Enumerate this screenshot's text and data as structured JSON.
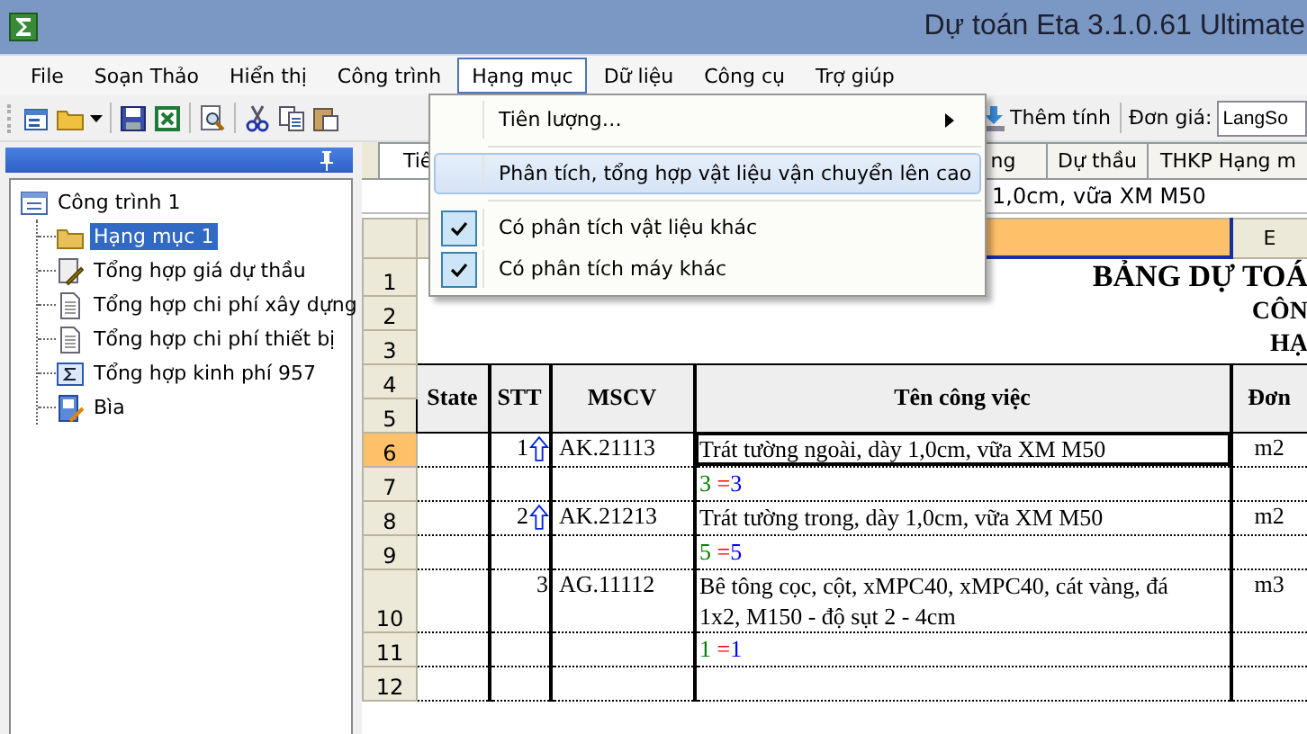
{
  "window": {
    "title": "Dự toán Eta 3.1.0.61 Ultimate"
  },
  "menu_bar": [
    {
      "label": "File",
      "selected": false
    },
    {
      "label": "Soạn Thảo",
      "selected": false
    },
    {
      "label": "Hiển thị",
      "selected": false
    },
    {
      "label": "Công trình",
      "selected": false
    },
    {
      "label": "Hạng mục",
      "selected": true
    },
    {
      "label": "Dữ liệu",
      "selected": false
    },
    {
      "label": "Công cụ",
      "selected": false
    },
    {
      "label": "Trợ giúp",
      "selected": false
    }
  ],
  "toolbar": {
    "add_button": "Thêm tính",
    "price_label": "Đơn giá:",
    "price_value": "LangSo"
  },
  "dropdown": [
    {
      "kind": "submenu",
      "label": "Tiên lượng…",
      "selected": false
    },
    {
      "kind": "action",
      "label": "Phân tích, tổng hợp vật liệu vận chuyển lên cao",
      "selected": true
    },
    {
      "kind": "toggle",
      "label": "Có phân tích vật liệu khác",
      "checked": true,
      "selected": false
    },
    {
      "kind": "toggle",
      "label": "Có phân tích máy khác",
      "checked": true,
      "selected": false
    }
  ],
  "tree": {
    "label": "Công trình 1",
    "children": [
      {
        "kind": "folder",
        "label": "Hạng mục 1",
        "selected": true
      },
      {
        "kind": "bid",
        "label": "Tổng hợp giá dự thầu",
        "selected": false
      },
      {
        "kind": "document",
        "label": "Tổng hợp chi phí xây dựng",
        "selected": false
      },
      {
        "kind": "document",
        "label": "Tổng hợp chi phí thiết bị",
        "selected": false
      },
      {
        "kind": "sum",
        "label": "Tổng hợp kinh phí 957",
        "selected": false
      },
      {
        "kind": "cover",
        "label": "Bìa",
        "selected": false
      }
    ]
  },
  "sheet_tabs": [
    {
      "label": "Tiê",
      "selected": true
    },
    {
      "label": "ng",
      "selected": false
    },
    {
      "label": "Dự thầu",
      "selected": false
    },
    {
      "label": "THKP Hạng m",
      "selected": false
    }
  ],
  "formula_bar": "1,0cm, vữa XM M50",
  "column_headers": [
    {
      "selected": true
    },
    {
      "label": "E",
      "selected": false
    }
  ],
  "title_lines": [
    {
      "number": "1",
      "text": "BẢNG DỰ TOÁ"
    },
    {
      "number": "2",
      "text": "CÔN"
    },
    {
      "number": "3",
      "text": "HẠ"
    }
  ],
  "header": {
    "numbers": [
      "4",
      "5"
    ],
    "cells": [
      "State",
      "STT",
      "MSCV",
      "Tên công việc",
      "Đơn"
    ]
  },
  "rows": [
    {
      "number": "6",
      "kind": "task",
      "selected": true,
      "stt": "1",
      "arrow": true,
      "code": "AK.21113",
      "name": "Trát tường ngoài, dày 1,0cm, vữa XM M50",
      "unit": "m2"
    },
    {
      "number": "7",
      "kind": "formula",
      "selected": false,
      "quantity": "3",
      "sign": "=",
      "result": "3"
    },
    {
      "number": "8",
      "kind": "task",
      "selected": false,
      "stt": "2",
      "arrow": true,
      "code": "AK.21213",
      "name": "Trát tường trong, dày 1,0cm, vữa XM M50",
      "unit": "m2"
    },
    {
      "number": "9",
      "kind": "formula",
      "selected": false,
      "quantity": "5",
      "sign": "=",
      "result": "5"
    },
    {
      "number": "10",
      "kind": "task",
      "selected": false,
      "stt": "3",
      "arrow": false,
      "code": "AG.11112",
      "name": "Bê tông cọc, cột, xMPC40, xMPC40, cát vàng, đá 1x2, M150 - độ sụt 2 - 4cm",
      "unit": "m3"
    },
    {
      "number": "11",
      "kind": "formula",
      "selected": false,
      "quantity": "1",
      "sign": "=",
      "result": "1"
    },
    {
      "number": "12",
      "kind": "empty",
      "selected": false
    }
  ]
}
